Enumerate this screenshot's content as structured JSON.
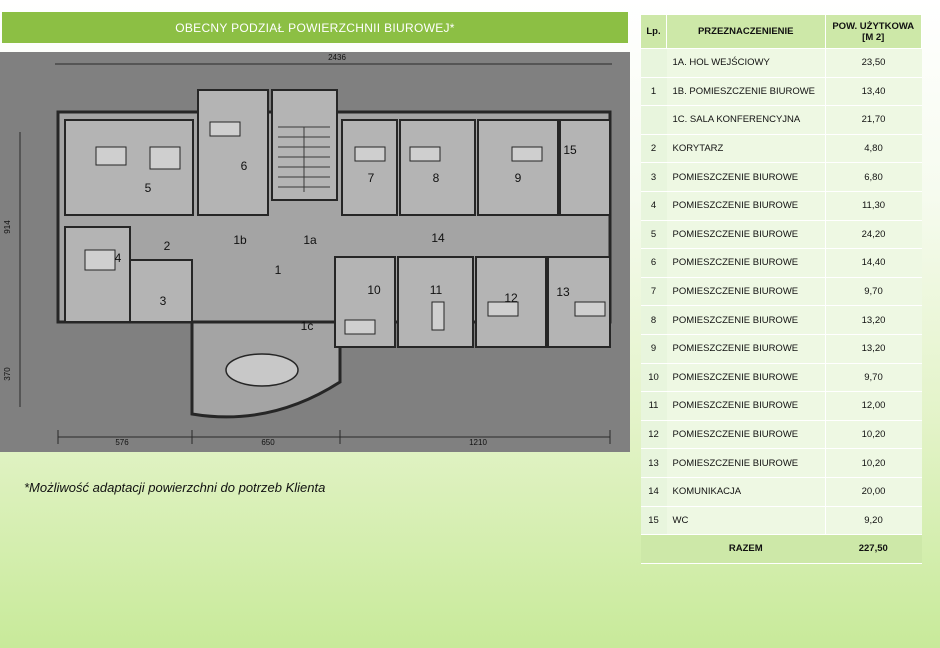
{
  "title": "OBECNY  PODZIAŁ POWIERZCHNII BIUROWEJ*",
  "footnote": "*Możliwość adaptacji powierzchni do potrzeb Klienta",
  "dimensions": {
    "top": "2436",
    "left_upper": "914",
    "left_lower": "370",
    "bottom_a": "576",
    "bottom_b": "650",
    "bottom_c": "1210"
  },
  "room_labels": [
    "1",
    "1a",
    "1b",
    "1c",
    "2",
    "3",
    "4",
    "5",
    "6",
    "7",
    "8",
    "9",
    "10",
    "11",
    "12",
    "13",
    "14",
    "15"
  ],
  "table": {
    "headers": {
      "lp": "Lp.",
      "name": "PRZEZNACZENIENIE",
      "area": "POW. UŻYTKOWA [M 2]"
    },
    "rows": [
      {
        "lp": "",
        "name": "1A. HOL WEJŚCIOWY",
        "area": "23,50"
      },
      {
        "lp": "1",
        "name": "1B. POMIESZCZENIE BIUROWE",
        "area": "13,40"
      },
      {
        "lp": "",
        "name": "1C. SALA KONFERENCYJNA",
        "area": "21,70"
      },
      {
        "lp": "2",
        "name": "KORYTARZ",
        "area": "4,80"
      },
      {
        "lp": "3",
        "name": "POMIESZCZENIE BIUROWE",
        "area": "6,80"
      },
      {
        "lp": "4",
        "name": "POMIESZCZENIE BIUROWE",
        "area": "11,30"
      },
      {
        "lp": "5",
        "name": "POMIESZCZENIE BIUROWE",
        "area": "24,20"
      },
      {
        "lp": "6",
        "name": "POMIESZCZENIE BIUROWE",
        "area": "14,40"
      },
      {
        "lp": "7",
        "name": "POMIESZCZENIE BIUROWE",
        "area": "9,70"
      },
      {
        "lp": "8",
        "name": "POMIESZCZENIE BIUROWE",
        "area": "13,20"
      },
      {
        "lp": "9",
        "name": "POMIESZCZENIE BIUROWE",
        "area": "13,20"
      },
      {
        "lp": "10",
        "name": "POMIESZCZENIE BIUROWE",
        "area": "9,70"
      },
      {
        "lp": "11",
        "name": "POMIESZCZENIE BIUROWE",
        "area": "12,00"
      },
      {
        "lp": "12",
        "name": "POMIESZCZENIE BIUROWE",
        "area": "10,20"
      },
      {
        "lp": "13",
        "name": "POMIESZCZENIE BIUROWE",
        "area": "10,20"
      },
      {
        "lp": "14",
        "name": "KOMUNIKACJA",
        "area": "20,00"
      },
      {
        "lp": "15",
        "name": "WC",
        "area": "9,20"
      }
    ],
    "total": {
      "label": "RAZEM",
      "area": "227,50"
    }
  },
  "colors": {
    "title_bar": "#8cbf44",
    "header": "#cde8a8",
    "row": "#eef8e3",
    "plan_bg": "#808080"
  }
}
